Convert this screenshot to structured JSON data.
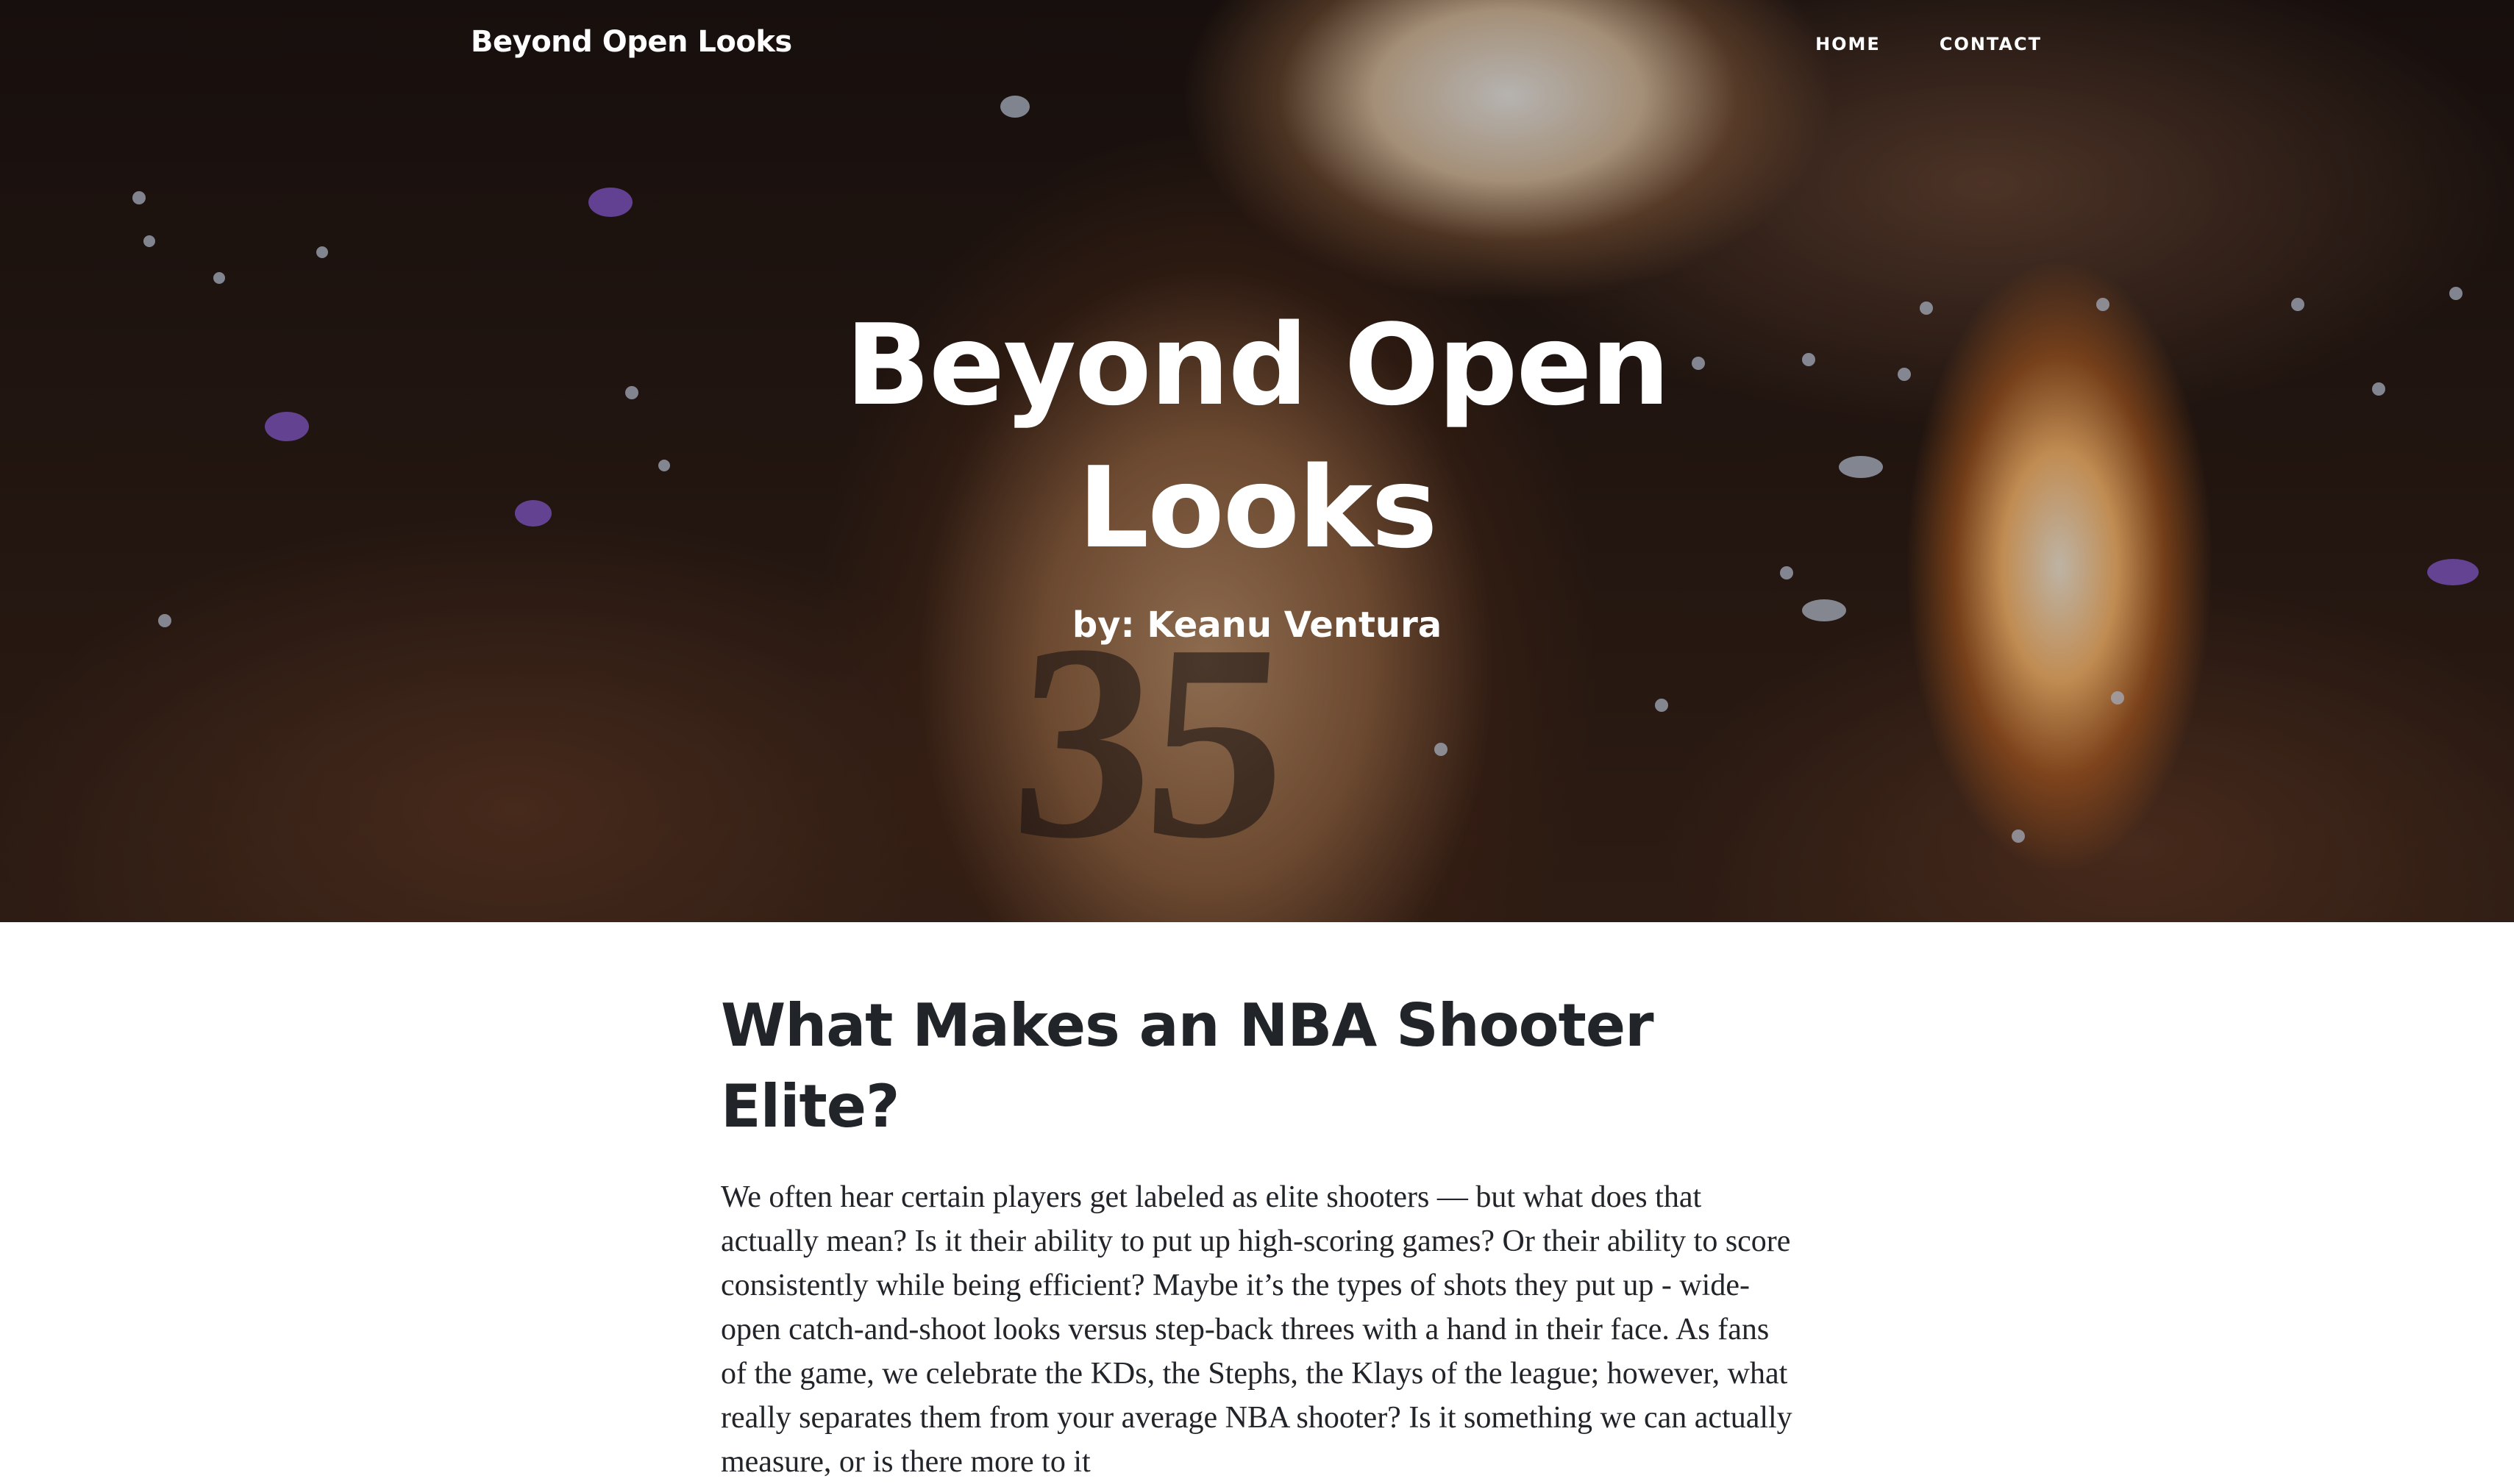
{
  "navbar": {
    "brand": "Beyond Open Looks",
    "links": [
      "HOME",
      "CONTACT"
    ]
  },
  "hero": {
    "title": "Beyond Open Looks",
    "subtitle": "by: Keanu Ventura",
    "background_image": "basketball player wearing jersey number 35 facing arena crowd with pyrotechnic flames",
    "jersey_number": "35"
  },
  "article": {
    "title": "What Makes an NBA Shooter Elite?",
    "body": "We often hear certain players get labeled as elite shooters — but what does that actually mean? Is it their ability to put up high-scoring games? Or their ability to score consistently while being efficient? Maybe it’s the types of shots they put up - wide-open catch-and-shoot looks versus step-back threes with a hand in their face. As fans of the game, we celebrate the KDs, the Stephs, the Klays of the league; however, what really separates them from your average NBA shooter? Is it something we can actually measure, or is there more to it"
  },
  "colors": {
    "text_dark": "#212529",
    "hero_text": "#ffffff",
    "page_background": "#ffffff"
  }
}
